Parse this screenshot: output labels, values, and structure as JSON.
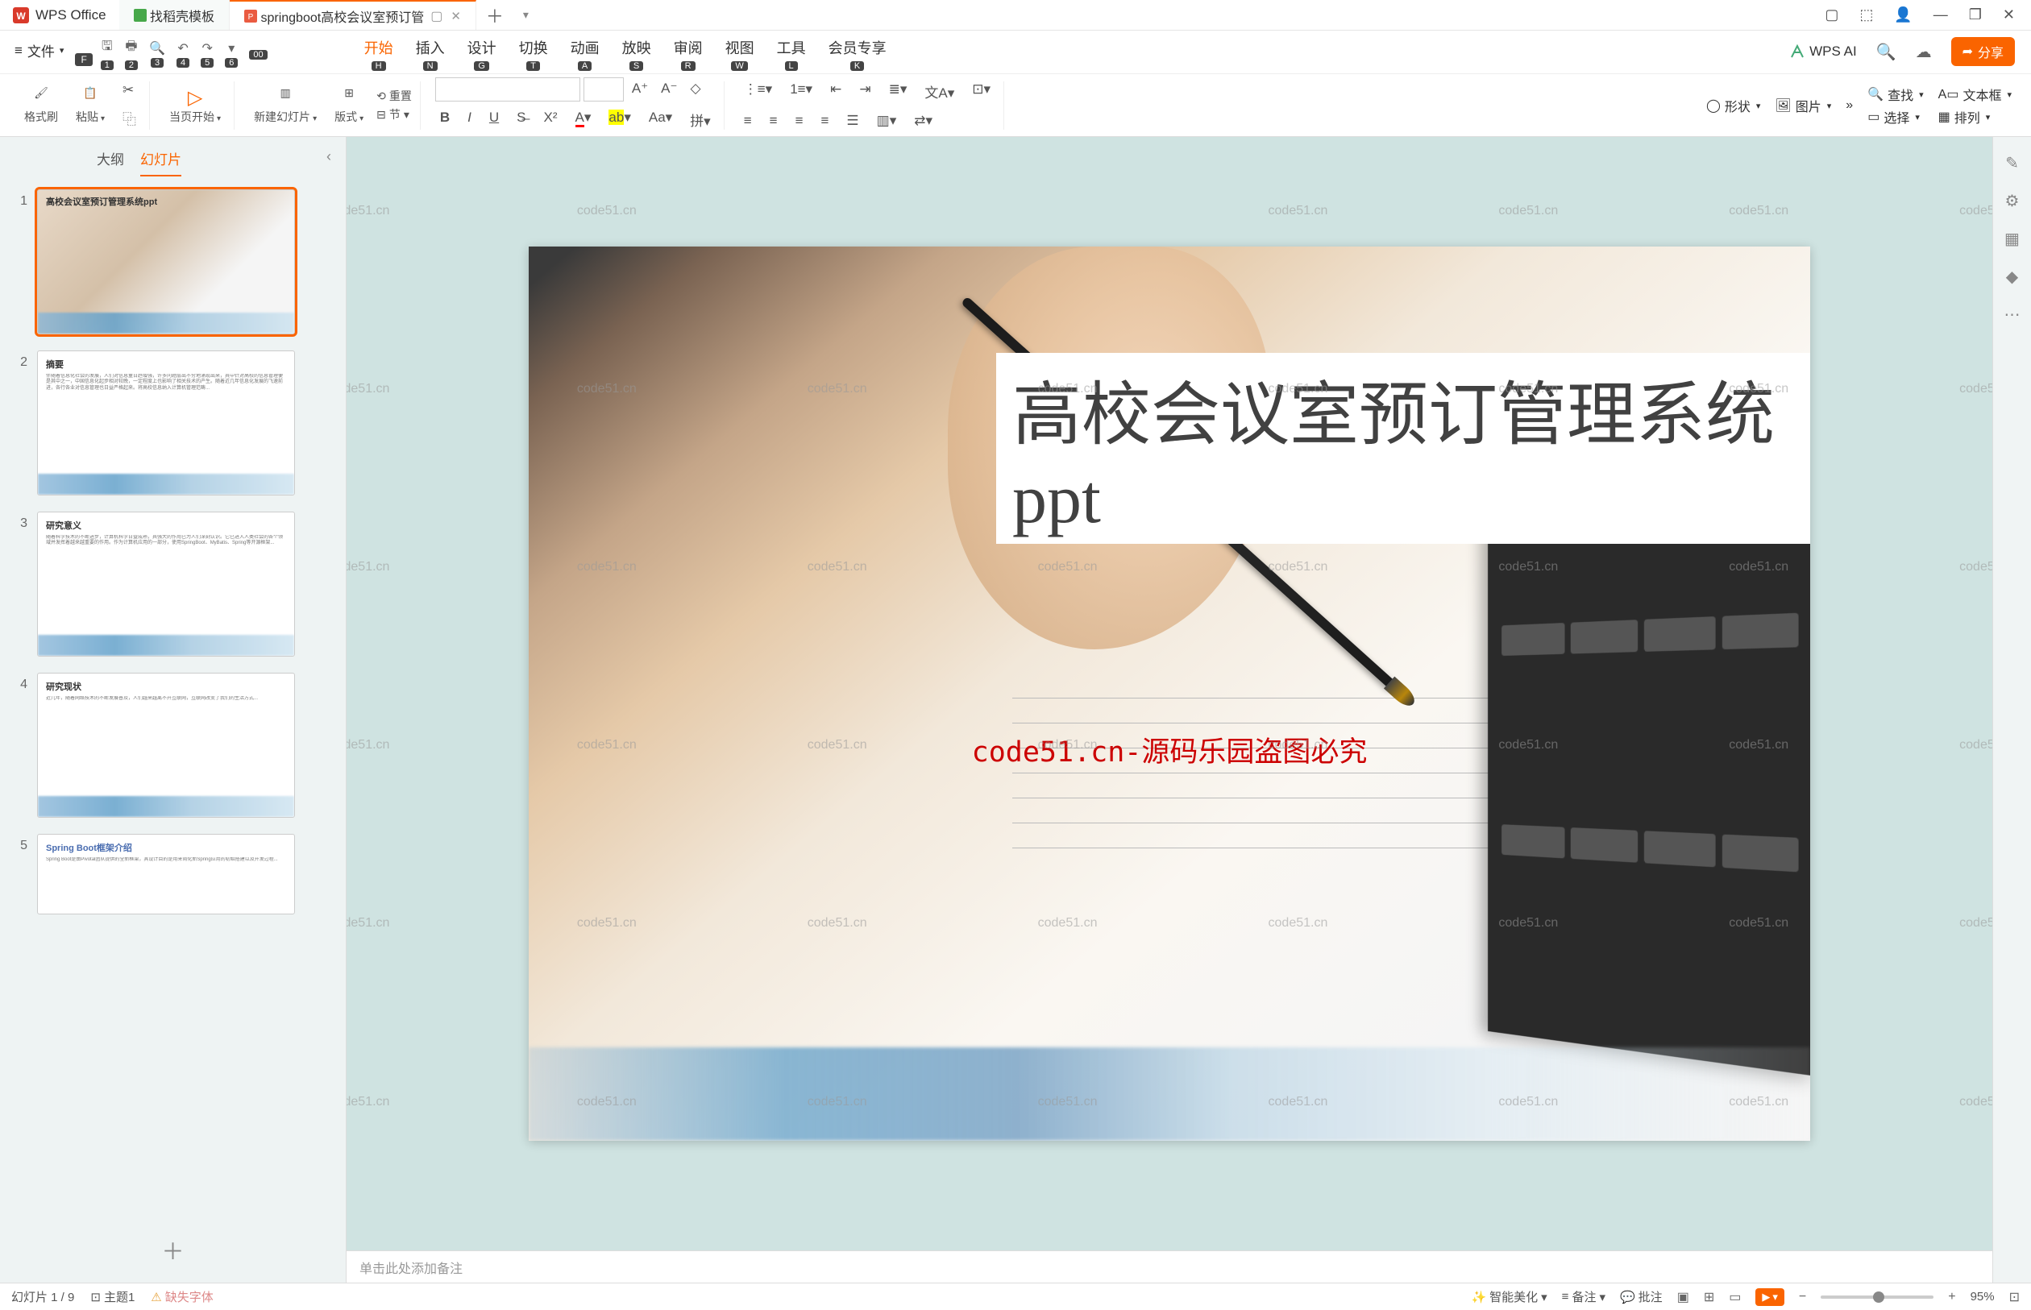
{
  "titlebar": {
    "app_name": "WPS Office",
    "tabs": [
      {
        "label": "找稻壳模板",
        "icon": "template-icon",
        "active": false
      },
      {
        "label": "springboot高校会议室预订管",
        "icon": "ppt-icon",
        "active": true
      }
    ],
    "window_controls": [
      "min",
      "cube",
      "avatar",
      "minimize",
      "maximize",
      "close"
    ]
  },
  "menu": {
    "file": "文件",
    "file_key": "F",
    "qat_keys": [
      "1",
      "2",
      "3",
      "4",
      "5",
      "6",
      "00"
    ],
    "items": [
      {
        "label": "开始",
        "key": "H",
        "active": true
      },
      {
        "label": "插入",
        "key": "N"
      },
      {
        "label": "设计",
        "key": "G"
      },
      {
        "label": "切换",
        "key": "T"
      },
      {
        "label": "动画",
        "key": "A"
      },
      {
        "label": "放映",
        "key": "S"
      },
      {
        "label": "审阅",
        "key": "R"
      },
      {
        "label": "视图",
        "key": "W"
      },
      {
        "label": "工具",
        "key": "L"
      },
      {
        "label": "会员专享",
        "key": "K"
      }
    ],
    "wps_ai": "WPS AI",
    "share": "分享"
  },
  "ribbon": {
    "format_brush": "格式刷",
    "paste": "粘贴",
    "from_current": "当页开始",
    "new_slide": "新建幻灯片",
    "layout": "版式",
    "section": "节",
    "reset": "重置",
    "shape": "形状",
    "picture": "图片",
    "textbox": "文本框",
    "arrange": "排列",
    "find": "查找",
    "select": "选择"
  },
  "sidebar": {
    "tab_outline": "大纲",
    "tab_slides": "幻灯片",
    "thumbs": [
      {
        "num": "1",
        "title": "高校会议室预订管理系统ppt",
        "selected": true
      },
      {
        "num": "2",
        "title": "摘要"
      },
      {
        "num": "3",
        "title": "研究意义"
      },
      {
        "num": "4",
        "title": "研究现状"
      },
      {
        "num": "5",
        "title": "Spring Boot框架介绍"
      }
    ]
  },
  "slide": {
    "title": "高校会议室预订管理系统ppt",
    "watermark": "code51.cn-源码乐园盗图必究",
    "bg_watermark": "code51.cn"
  },
  "notes": {
    "placeholder": "单击此处添加备注"
  },
  "status": {
    "slide_counter": "幻灯片 1 / 9",
    "theme": "主题1",
    "missing_font": "缺失字体",
    "smart_beautify": "智能美化",
    "notes_btn": "备注",
    "review_btn": "批注",
    "zoom": "95%"
  }
}
